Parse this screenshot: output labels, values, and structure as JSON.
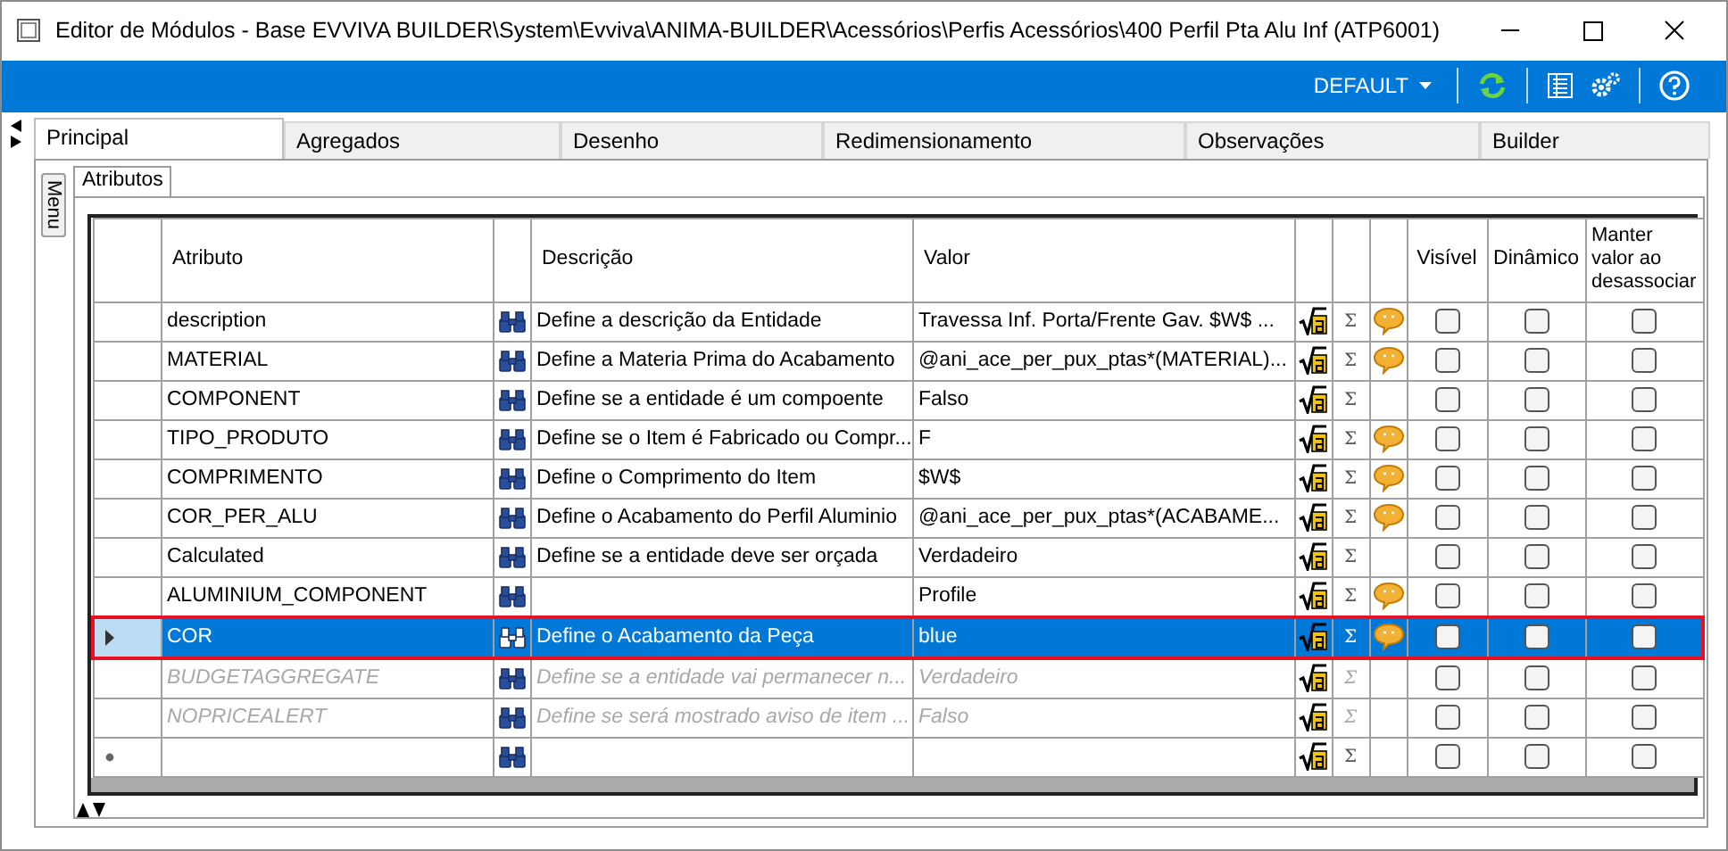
{
  "window": {
    "title": "Editor de Módulos - Base EVVIVA BUILDER\\System\\Evviva\\ANIMA-BUILDER\\Acessórios\\Perfis Acessórios\\400 Perfil Pta Alu Inf (ATP6001)"
  },
  "toolbar": {
    "profile": "DEFAULT"
  },
  "tabs": [
    {
      "label": "Principal",
      "selected": true
    },
    {
      "label": "Agregados",
      "selected": false
    },
    {
      "label": "Desenho",
      "selected": false
    },
    {
      "label": "Redimensionamento",
      "selected": false
    },
    {
      "label": "Observações",
      "selected": false
    },
    {
      "label": "Builder",
      "selected": false
    }
  ],
  "side_button": "Menu",
  "subtabs": [
    {
      "label": "Atributos",
      "selected": true
    }
  ],
  "columns": {
    "attribute": "Atributo",
    "description": "Descrição",
    "value": "Valor",
    "visible": "Visível",
    "dynamic": "Dinâmico",
    "keep": "Manter valor ao desassociar"
  },
  "rows": [
    {
      "kind": "data",
      "attribute": "description",
      "description": "Define a descrição da Entidade",
      "value": "Travessa Inf. Porta/Frente Gav. $W$ ...",
      "sigma": "Σ",
      "comment": true,
      "disabled": false,
      "selected": false,
      "visible": false,
      "dynamic": false,
      "keep": false
    },
    {
      "kind": "data",
      "attribute": "MATERIAL",
      "description": "Define a Materia Prima do Acabamento",
      "value": "@ani_ace_per_pux_ptas*(MATERIAL)...",
      "sigma": "Σ",
      "comment": true,
      "disabled": false,
      "selected": false,
      "visible": false,
      "dynamic": false,
      "keep": false
    },
    {
      "kind": "data",
      "attribute": "COMPONENT",
      "description": "Define se a entidade é um compoente",
      "value": "Falso",
      "sigma": "Σ",
      "comment": false,
      "disabled": false,
      "selected": false,
      "visible": false,
      "dynamic": false,
      "keep": false
    },
    {
      "kind": "data",
      "attribute": "TIPO_PRODUTO",
      "description": "Define se o Item é Fabricado ou Compr...",
      "value": "F",
      "sigma": "Σ",
      "comment": true,
      "disabled": false,
      "selected": false,
      "visible": false,
      "dynamic": false,
      "keep": false
    },
    {
      "kind": "data",
      "attribute": "COMPRIMENTO",
      "description": "Define o Comprimento do Item",
      "value": "$W$",
      "sigma": "Σ",
      "comment": true,
      "disabled": false,
      "selected": false,
      "visible": false,
      "dynamic": false,
      "keep": false
    },
    {
      "kind": "data",
      "attribute": "COR_PER_ALU",
      "description": "Define o Acabamento do Perfil Aluminio",
      "value": "@ani_ace_per_pux_ptas*(ACABAME...",
      "sigma": "Σ",
      "comment": true,
      "disabled": false,
      "selected": false,
      "visible": false,
      "dynamic": false,
      "keep": false
    },
    {
      "kind": "data",
      "attribute": "Calculated",
      "description": "Define se a entidade deve ser orçada",
      "value": "Verdadeiro",
      "sigma": "Σ",
      "comment": false,
      "disabled": false,
      "selected": false,
      "visible": false,
      "dynamic": false,
      "keep": false
    },
    {
      "kind": "data",
      "attribute": "ALUMINIUM_COMPONENT",
      "value": "Profile",
      "sigma": "Σ",
      "comment": true,
      "disabled": false,
      "selected": false,
      "visible": false,
      "dynamic": false,
      "keep": false
    },
    {
      "kind": "data",
      "attribute": "COR",
      "description": "Define o Acabamento da Peça",
      "value": "blue",
      "sigma": "Σ",
      "comment": true,
      "disabled": false,
      "selected": true,
      "visible": false,
      "dynamic": false,
      "keep": false
    },
    {
      "kind": "data",
      "attribute": "BUDGETAGGREGATE",
      "description": "Define se a entidade vai permanecer n...",
      "value": "Verdadeiro",
      "sigma": "Σ",
      "comment": false,
      "disabled": true,
      "selected": false,
      "visible": false,
      "dynamic": false,
      "keep": false
    },
    {
      "kind": "data",
      "attribute": "NOPRICEALERT",
      "description": "Define se será mostrado aviso de item ...",
      "value": "Falso",
      "sigma": "Σ",
      "comment": false,
      "disabled": true,
      "selected": false,
      "visible": false,
      "dynamic": false,
      "keep": false
    },
    {
      "kind": "new",
      "sigma": "Σ",
      "comment": false,
      "disabled": false,
      "selected": false,
      "visible": false,
      "dynamic": false,
      "keep": false
    }
  ]
}
